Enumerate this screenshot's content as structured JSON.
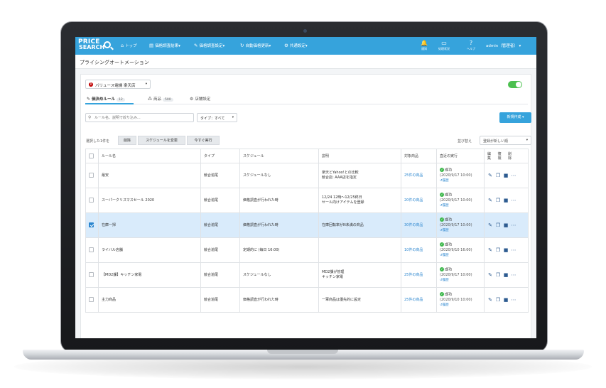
{
  "nav": {
    "logo_line1": "PRICE",
    "logo_line2": "SEARCH",
    "items": [
      {
        "icon": "home-icon",
        "glyph": "⌂",
        "label": "トップ"
      },
      {
        "icon": "list-icon",
        "glyph": "▤",
        "label": "価格調査結果▾"
      },
      {
        "icon": "wrench-icon",
        "glyph": "✎",
        "label": "価格調査設定▾"
      },
      {
        "icon": "refresh-icon",
        "glyph": "↻",
        "label": "自動価格更新▾"
      },
      {
        "icon": "gear-icon",
        "glyph": "⚙",
        "label": "共通設定▾"
      }
    ],
    "right": [
      {
        "icon": "bell-icon",
        "glyph": "🔔",
        "label": "通知"
      },
      {
        "icon": "monitor-icon",
        "glyph": "▭",
        "label": "処理状況"
      },
      {
        "icon": "help-icon",
        "glyph": "?",
        "label": "ヘルプ"
      }
    ],
    "user": "admin（管理者）"
  },
  "page_title": "プライシングオートメーション",
  "store_select": {
    "label": "バリュース電機 楽天店",
    "icon_text": "R"
  },
  "tabs": [
    {
      "label": "価決めルール",
      "badge": "12"
    },
    {
      "label": "商品",
      "badge": "500"
    },
    {
      "label": "店舗設定",
      "badge": ""
    }
  ],
  "search": {
    "placeholder": "ルール名、説明で絞り込み..."
  },
  "type_filter": {
    "label": "タイプ：すべて"
  },
  "new_button": "新規作成 ▾",
  "selection": {
    "info": "選択した1件を",
    "delete": "削除",
    "change_schedule": "スケジュールを変更",
    "run_now": "今すぐ実行"
  },
  "sort": {
    "label": "並び替え",
    "value": "登録が新しい順"
  },
  "table": {
    "headers": {
      "name": "ルール名",
      "type": "タイプ",
      "schedule": "スケジュール",
      "description": "説明",
      "targets": "対象商品",
      "last_run": "直近の実行",
      "ops": "編 複 削\n集 製 除"
    },
    "rows": [
      {
        "checked": false,
        "name": "最安",
        "type": "競合追尾",
        "schedule": "スケジュールなし",
        "description": "楽天とYahoo!との比較\n競合店: AAA店を指定",
        "targets": "25件の商品",
        "status": "成功",
        "date": "(2020/9/17 10:00)",
        "history": "履歴"
      },
      {
        "checked": false,
        "name": "スーパークリスマスセール 2020",
        "type": "競合追尾",
        "schedule": "価格調査が行われた時",
        "description": "12/24 12時〜12/25終日\nセール向けアイテムを登録",
        "targets": "20件の商品",
        "status": "成功",
        "date": "(2020/9/17 10:00)",
        "history": "履歴"
      },
      {
        "checked": true,
        "name": "在庫一掃",
        "type": "競合追尾",
        "schedule": "価格調査が行われた時",
        "description": "在庫回転率がN未満の商品",
        "targets": "30件の商品",
        "status": "成功",
        "date": "(2020/9/17 10:00)",
        "history": "履歴"
      },
      {
        "checked": false,
        "name": "ライバル店舗",
        "type": "競合追尾",
        "schedule": "定期的に (毎日 16:00)",
        "description": "",
        "targets": "10件の商品",
        "status": "成功",
        "date": "(2020/9/10 16:00)",
        "history": "履歴"
      },
      {
        "checked": false,
        "name": "【MD2課】キッチン家電",
        "type": "競合追尾",
        "schedule": "スケジュールなし",
        "description": "MD2課が管理\nキッチン家電",
        "targets": "25件の商品",
        "status": "成功",
        "date": "(2020/9/17 10:00)",
        "history": "履歴"
      },
      {
        "checked": false,
        "name": "主力商品",
        "type": "競合追尾",
        "schedule": "価格調査が行われた時",
        "description": "一軍商品は優先的に設定",
        "targets": "25件の商品",
        "status": "成功",
        "date": "(2020/9/10 10:00)",
        "history": "履歴"
      }
    ]
  },
  "colors": {
    "navbar": "#36a3dc",
    "link": "#2b86cf",
    "selected_row": "#d9ebfb",
    "toggle_on": "#4cc04f"
  }
}
